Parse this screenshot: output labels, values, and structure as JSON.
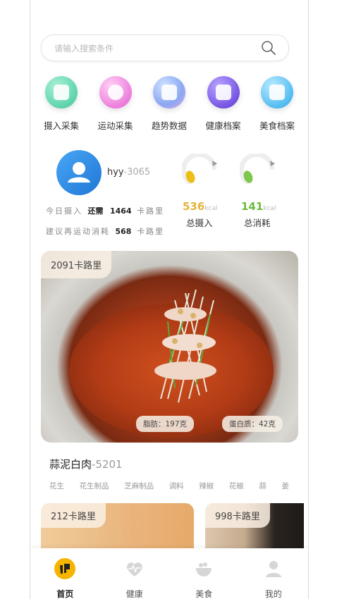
{
  "search": {
    "placeholder": "请输入搜索条件"
  },
  "quick_actions": [
    {
      "label": "摄入采集",
      "icon": "intake-collect-icon",
      "color": "#52d0a8"
    },
    {
      "label": "运动采集",
      "icon": "sport-collect-icon",
      "color": "#f27ce0"
    },
    {
      "label": "趋势数据",
      "icon": "trend-data-icon",
      "color": "#7fb4f2"
    },
    {
      "label": "健康档案",
      "icon": "health-record-icon",
      "color": "#7a55e6"
    },
    {
      "label": "美食档案",
      "icon": "food-record-icon",
      "color": "#52b9f0"
    }
  ],
  "user": {
    "name": "hyy",
    "id": "-3065"
  },
  "stats": {
    "line1_prefix": "今日摄入",
    "line1_mid": "还需",
    "line1_value": "1464",
    "line1_unit": "卡路里",
    "line2_prefix": "建议再运动消耗",
    "line2_value": "568",
    "line2_unit": "卡路里"
  },
  "intake": {
    "value": "536",
    "unit": "kcal",
    "label": "总摄入",
    "color": "#e4b43a"
  },
  "burn": {
    "value": "141",
    "unit": "kcal",
    "label": "总消耗",
    "color": "#6cbb3a"
  },
  "featured": {
    "calories": "2091卡路里",
    "fat": "脂肪：197克",
    "protein": "蛋白质：42克",
    "name": "蒜泥白肉",
    "id": "-5201",
    "ingredients": [
      "花生",
      "花生制品",
      "芝麻制品",
      "调料",
      "辣椒",
      "花椒",
      "蒜",
      "姜"
    ]
  },
  "cards": [
    {
      "calories": "212卡路里"
    },
    {
      "calories": "998卡路里"
    }
  ],
  "tabs": [
    {
      "label": "首页",
      "icon": "home-icon",
      "active": true
    },
    {
      "label": "健康",
      "icon": "heart-pulse-icon"
    },
    {
      "label": "美食",
      "icon": "food-bowl-icon"
    },
    {
      "label": "我的",
      "icon": "user-icon"
    }
  ]
}
